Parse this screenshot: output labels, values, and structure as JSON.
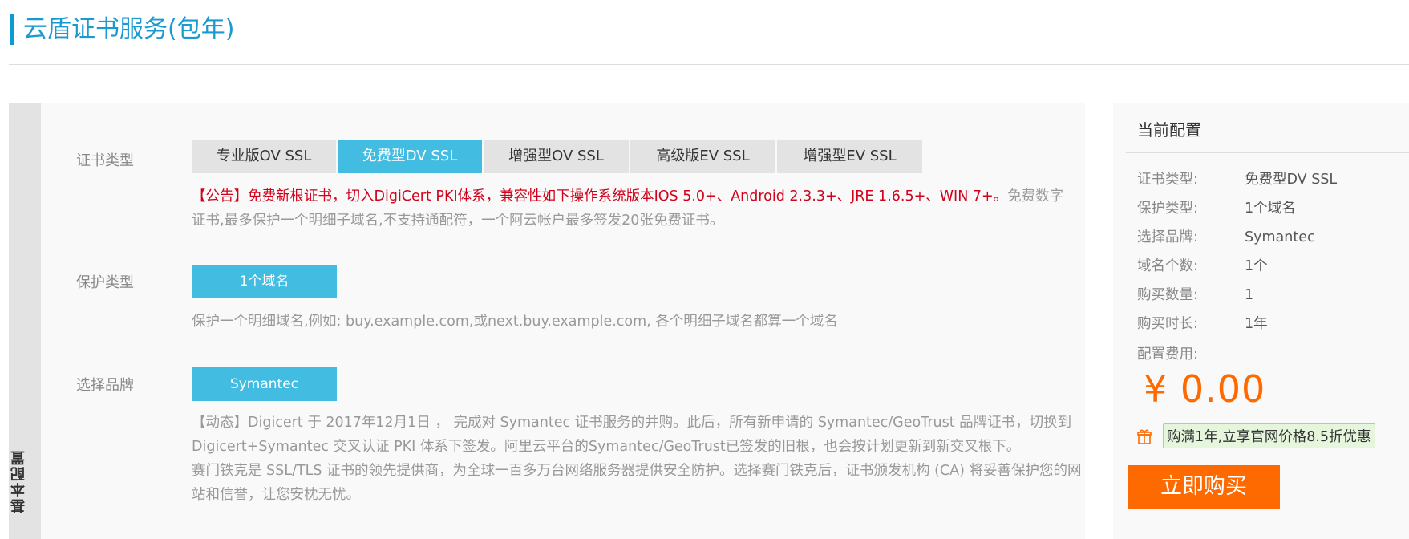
{
  "page": {
    "title": "云盾证书服务(包年)"
  },
  "panel": {
    "tab_label": "基本配置"
  },
  "cert_type": {
    "label": "证书类型",
    "options": [
      "专业版OV SSL",
      "免费型DV SSL",
      "增强型OV SSL",
      "高级版EV SSL",
      "增强型EV SSL"
    ],
    "selected": "免费型DV SSL",
    "notice_red": "【公告】免费新根证书，切入DigiCert PKI体系，兼容性如下操作系统版本IOS 5.0+、Android 2.3.3+、JRE 1.6.5+、WIN 7+。",
    "notice_gray": "免费数字证书,最多保护一个明细子域名,不支持通配符，一个阿云帐户最多签发20张免费证书。"
  },
  "protect_type": {
    "label": "保护类型",
    "option": "1个域名",
    "description": "保护一个明细域名,例如: buy.example.com,或next.buy.example.com, 各个明细子域名都算一个域名"
  },
  "brand": {
    "label": "选择品牌",
    "option": "Symantec",
    "description_1": "【动态】Digicert 于 2017年12月1日 ， 完成对 Symantec 证书服务的并购。此后，所有新申请的 Symantec/GeoTrust 品牌证书，切换到 Digicert+Symantec 交叉认证 PKI 体系下签发。阿里云平台的Symantec/GeoTrust已签发的旧根，也会按计划更新到新交叉根下。",
    "description_2": "赛门铁克是 SSL/TLS 证书的领先提供商，为全球一百多万台网络服务器提供安全防护。选择赛门铁克后，证书颁发机构 (CA) 将妥善保护您的网站和信誉，让您安枕无忧。"
  },
  "summary": {
    "title": "当前配置",
    "rows": [
      {
        "key": "证书类型:",
        "value": "免费型DV SSL"
      },
      {
        "key": "保护类型:",
        "value": "1个域名"
      },
      {
        "key": "选择品牌:",
        "value": "Symantec"
      },
      {
        "key": "域名个数:",
        "value": "1个"
      },
      {
        "key": "购买数量:",
        "value": "1"
      },
      {
        "key": "购买时长:",
        "value": "1年"
      }
    ],
    "fee_label": "配置费用:",
    "price": "¥ 0.00",
    "promo_icon": "gift-icon",
    "promo": "购满1年,立享官网价格8.5折优惠",
    "buy_label": "立即购买"
  },
  "colors": {
    "accent": "#43bce2",
    "title": "#1a9ad0",
    "price": "#ff6a00",
    "notice": "#d0021b"
  }
}
